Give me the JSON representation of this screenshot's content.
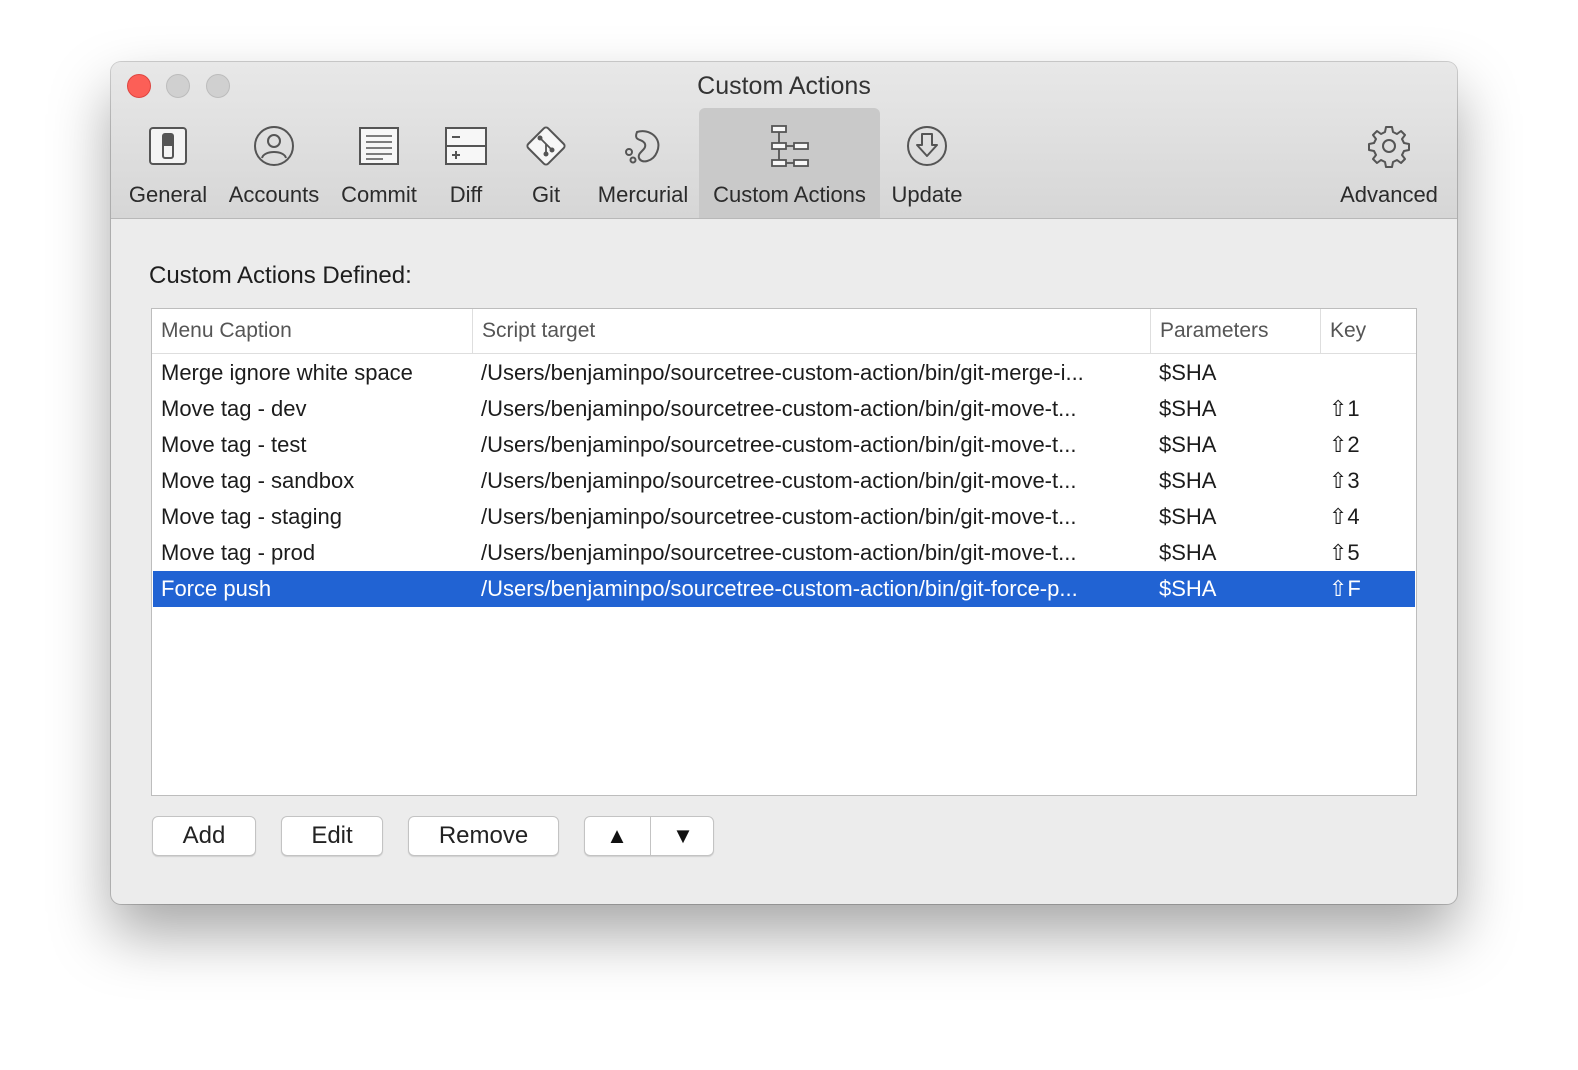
{
  "window": {
    "title": "Custom Actions"
  },
  "toolbar": {
    "tabs": [
      {
        "label": "General",
        "icon": "general-switch-icon"
      },
      {
        "label": "Accounts",
        "icon": "accounts-person-icon"
      },
      {
        "label": "Commit",
        "icon": "commit-document-icon"
      },
      {
        "label": "Diff",
        "icon": "diff-icon"
      },
      {
        "label": "Git",
        "icon": "git-diamond-icon"
      },
      {
        "label": "Mercurial",
        "icon": "mercurial-icon"
      },
      {
        "label": "Custom Actions",
        "icon": "custom-actions-tree-icon",
        "selected": true
      },
      {
        "label": "Update",
        "icon": "update-download-icon"
      },
      {
        "label": "Advanced",
        "icon": "gear-icon"
      }
    ]
  },
  "content": {
    "heading": "Custom Actions Defined:"
  },
  "table": {
    "headers": {
      "caption": "Menu Caption",
      "target": "Script target",
      "params": "Parameters",
      "key": "Key"
    },
    "rows": [
      {
        "caption": "Merge ignore white space",
        "target": "/Users/benjaminpo/sourcetree-custom-action/bin/git-merge-i...",
        "params": "$SHA",
        "key": ""
      },
      {
        "caption": "Move tag - dev",
        "target": "/Users/benjaminpo/sourcetree-custom-action/bin/git-move-t...",
        "params": "$SHA",
        "key": "⇧1"
      },
      {
        "caption": "Move tag - test",
        "target": "/Users/benjaminpo/sourcetree-custom-action/bin/git-move-t...",
        "params": "$SHA",
        "key": "⇧2"
      },
      {
        "caption": "Move tag - sandbox",
        "target": "/Users/benjaminpo/sourcetree-custom-action/bin/git-move-t...",
        "params": "$SHA",
        "key": "⇧3"
      },
      {
        "caption": "Move tag - staging",
        "target": "/Users/benjaminpo/sourcetree-custom-action/bin/git-move-t...",
        "params": "$SHA",
        "key": "⇧4"
      },
      {
        "caption": "Move tag - prod",
        "target": "/Users/benjaminpo/sourcetree-custom-action/bin/git-move-t...",
        "params": "$SHA",
        "key": "⇧5"
      },
      {
        "caption": "Force push",
        "target": "/Users/benjaminpo/sourcetree-custom-action/bin/git-force-p...",
        "params": "$SHA",
        "key": "⇧F",
        "selected": true
      }
    ]
  },
  "buttons": {
    "add": "Add",
    "edit": "Edit",
    "remove": "Remove",
    "move_up": "▲",
    "move_down": "▼"
  },
  "colors": {
    "selection": "#2163d3",
    "close_button": "#fc5f57"
  }
}
